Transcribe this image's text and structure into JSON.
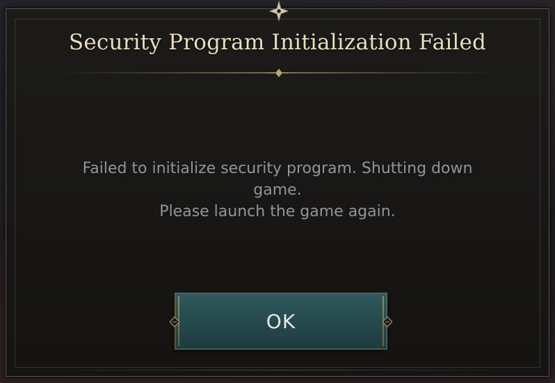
{
  "dialog": {
    "title": "Security Program Initialization Failed",
    "message_lines": [
      "Failed to initialize security program. Shutting down",
      "game.",
      "Please launch the game again."
    ],
    "ok_label": "OK"
  },
  "colors": {
    "title_text": "#e9ddc0",
    "message_text": "#8e959b",
    "button_fill": "#2a5256",
    "frame_gold": "#9b8a5e",
    "dialog_bg": "#1a1917"
  },
  "icons": {
    "top_ornament": "compass-star-icon",
    "title_ornament": "diamond-ornament-icon",
    "button_notch": "arrow-notch-icon"
  }
}
